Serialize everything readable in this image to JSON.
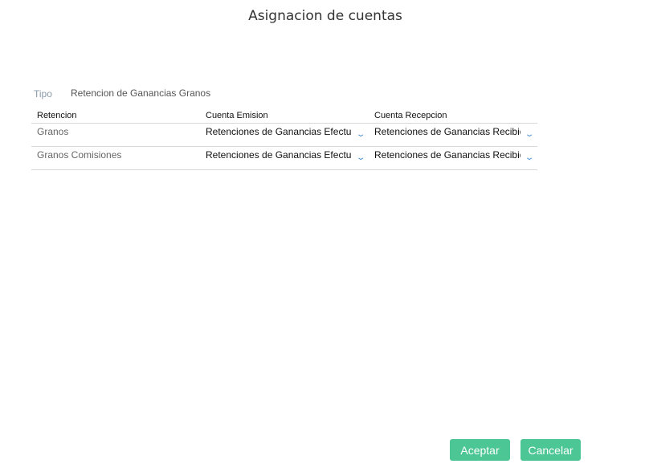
{
  "title": "Asignacion de cuentas",
  "tipo": {
    "label": "Tipo",
    "value": "Retencion de Ganancias Granos"
  },
  "table": {
    "headers": [
      "Retencion",
      "Cuenta Emision",
      "Cuenta Recepcion"
    ],
    "rows": [
      {
        "retencion": "Granos",
        "emision": "Retenciones de Ganancias Efectuadas",
        "recepcion": "Retenciones de Ganancias Recibidas"
      },
      {
        "retencion": "Granos Comisiones",
        "emision": "Retenciones de Ganancias Efectuadas",
        "recepcion": "Retenciones de Ganancias Recibidas"
      }
    ]
  },
  "buttons": {
    "accept": "Aceptar",
    "cancel": "Cancelar"
  }
}
